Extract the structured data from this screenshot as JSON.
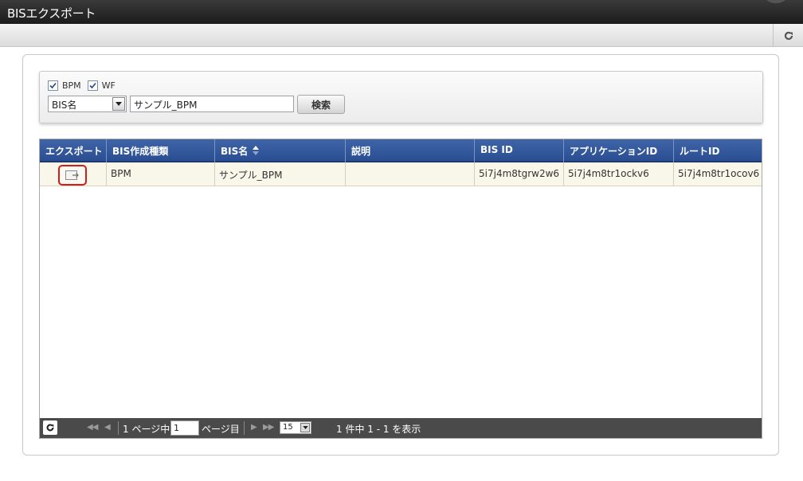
{
  "window": {
    "title": "BISエクスポート"
  },
  "toolbar": {
    "reload_icon": "reload-icon"
  },
  "search": {
    "checkboxes": [
      {
        "label": "BPM",
        "checked": true
      },
      {
        "label": "WF",
        "checked": true
      }
    ],
    "field_select": "BIS名",
    "keyword": "サンプル_BPM",
    "search_button": "検索"
  },
  "table": {
    "columns": [
      "エクスポート",
      "BIS作成種類",
      "BIS名",
      "説明",
      "BIS ID",
      "アプリケーションID",
      "ルートID"
    ],
    "sorted_column": "BIS名",
    "rows": [
      {
        "export_icon": "export-icon",
        "type": "BPM",
        "name": "サンプル_BPM",
        "description": "",
        "bis_id": "5i7j4m8tgrw2w6",
        "app_id": "5i7j4m8tr1ockv6",
        "root_id": "5i7j4m8tr1ocov6"
      }
    ]
  },
  "pager": {
    "first_icon": "first-page-icon",
    "prev_icon": "prev-page-icon",
    "next_icon": "next-page-icon",
    "last_icon": "last-page-icon",
    "page_prefix": "1 ページ中",
    "current_page": "1",
    "page_suffix": "ページ目",
    "per_page": "15",
    "summary": "1 件中 1 - 1 を表示"
  },
  "colors": {
    "header_bg": "#2f56a0",
    "row_bg": "#f9f6ea",
    "highlight": "#d21b1b",
    "title_bar": "#2a2a2a"
  }
}
